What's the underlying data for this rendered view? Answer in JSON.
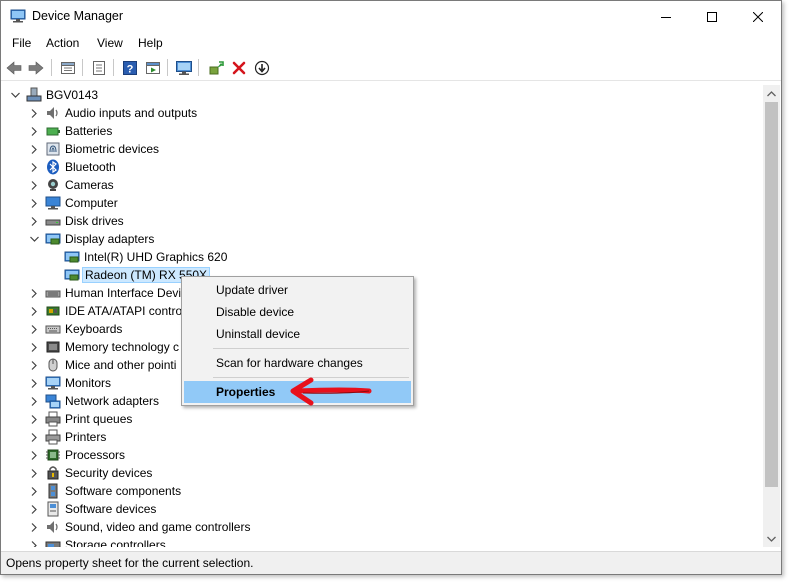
{
  "window": {
    "title": "Device Manager"
  },
  "menu": [
    "File",
    "Action",
    "View",
    "Help"
  ],
  "toolbar": {
    "icons": [
      "back-arrow-icon",
      "forward-arrow-icon",
      "properties-list-icon",
      "show-hide-console-tree-icon",
      "help-icon",
      "run-icon",
      "scan-hardware-icon",
      "update-driver-icon",
      "uninstall-icon",
      "download-icon"
    ]
  },
  "tree": {
    "root": "BGV0143",
    "items": [
      {
        "label": "Audio inputs and outputs",
        "icon": "speaker-icon"
      },
      {
        "label": "Batteries",
        "icon": "battery-icon"
      },
      {
        "label": "Biometric devices",
        "icon": "fingerprint-icon"
      },
      {
        "label": "Bluetooth",
        "icon": "bluetooth-icon"
      },
      {
        "label": "Cameras",
        "icon": "camera-icon"
      },
      {
        "label": "Computer",
        "icon": "computer-icon"
      },
      {
        "label": "Disk drives",
        "icon": "disk-drive-icon"
      },
      {
        "label": "Display adapters",
        "icon": "display-adapter-icon",
        "expanded": true,
        "children": [
          {
            "label": "Intel(R) UHD Graphics 620",
            "icon": "display-adapter-icon"
          },
          {
            "label": "Radeon (TM) RX 550X",
            "icon": "display-adapter-icon",
            "selected": true
          }
        ]
      },
      {
        "label": "Human Interface Devi",
        "icon": "hid-icon"
      },
      {
        "label": "IDE ATA/ATAPI control",
        "icon": "ide-controller-icon"
      },
      {
        "label": "Keyboards",
        "icon": "keyboard-icon"
      },
      {
        "label": "Memory technology c",
        "icon": "memory-icon"
      },
      {
        "label": "Mice and other pointi",
        "icon": "mouse-icon"
      },
      {
        "label": "Monitors",
        "icon": "monitor-icon"
      },
      {
        "label": "Network adapters",
        "icon": "network-adapter-icon"
      },
      {
        "label": "Print queues",
        "icon": "print-queue-icon"
      },
      {
        "label": "Printers",
        "icon": "printer-icon"
      },
      {
        "label": "Processors",
        "icon": "processor-icon"
      },
      {
        "label": "Security devices",
        "icon": "security-device-icon"
      },
      {
        "label": "Software components",
        "icon": "software-component-icon"
      },
      {
        "label": "Software devices",
        "icon": "software-device-icon"
      },
      {
        "label": "Sound, video and game controllers",
        "icon": "sound-icon"
      },
      {
        "label": "Storage controllers",
        "icon": "storage-controller-icon"
      }
    ]
  },
  "context_menu": {
    "items": [
      "Update driver",
      "Disable device",
      "Uninstall device",
      "Scan for hardware changes",
      "Properties"
    ],
    "highlighted": "Properties"
  },
  "status": {
    "text": "Opens property sheet for the current selection."
  },
  "colors": {
    "selection": "#cce8ff",
    "menu_highlight": "#91c9f7",
    "annotation_arrow": "#e8101c"
  }
}
